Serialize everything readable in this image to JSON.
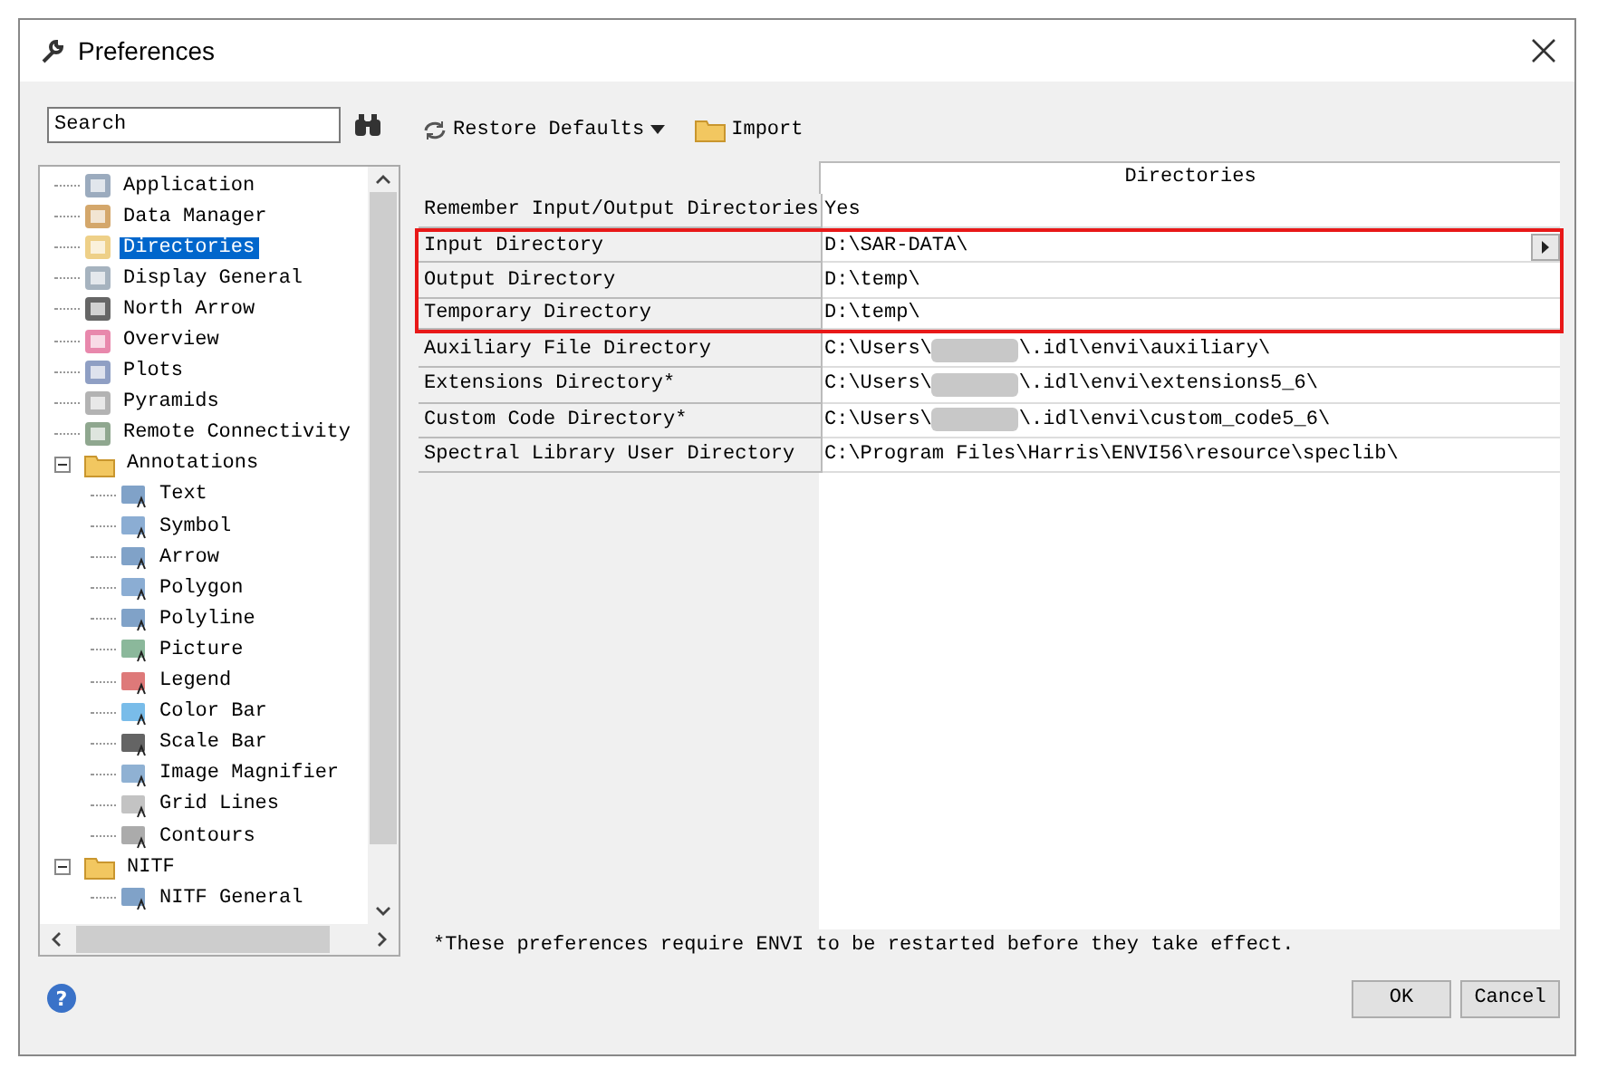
{
  "window": {
    "title": "Preferences"
  },
  "search": {
    "placeholder": "Search"
  },
  "tree": [
    {
      "label": "Application",
      "selected": false
    },
    {
      "label": "Data Manager",
      "selected": false
    },
    {
      "label": "Directories",
      "selected": true
    },
    {
      "label": "Display General",
      "selected": false
    },
    {
      "label": "North Arrow",
      "selected": false
    },
    {
      "label": "Overview",
      "selected": false
    },
    {
      "label": "Plots",
      "selected": false
    },
    {
      "label": "Pyramids",
      "selected": false
    },
    {
      "label": "Remote Connectivity",
      "selected": false
    },
    {
      "label": "Annotations",
      "selected": false,
      "expanded": true,
      "children": [
        {
          "label": "Text",
          "selected": false
        },
        {
          "label": "Symbol",
          "selected": false
        },
        {
          "label": "Arrow",
          "selected": false
        },
        {
          "label": "Polygon",
          "selected": false
        },
        {
          "label": "Polyline",
          "selected": false
        },
        {
          "label": "Picture",
          "selected": false
        },
        {
          "label": "Legend",
          "selected": false
        },
        {
          "label": "Color Bar",
          "selected": false
        },
        {
          "label": "Scale Bar",
          "selected": false
        },
        {
          "label": "Image Magnifier",
          "selected": false
        },
        {
          "label": "Grid Lines",
          "selected": false
        },
        {
          "label": "Contours",
          "selected": false
        }
      ]
    },
    {
      "label": "NITF",
      "selected": false,
      "expanded": true,
      "children": [
        {
          "label": "NITF General",
          "selected": false
        }
      ]
    }
  ],
  "toolbar": {
    "restore": "Restore Defaults",
    "import": "Import"
  },
  "table": {
    "column": "Directories",
    "rows": [
      {
        "name": "Remember Input/Output Directories",
        "value": "Yes",
        "highlighted": false
      },
      {
        "name": "Input Directory",
        "value": "D:\\SAR-DATA\\",
        "highlighted": true,
        "expand_button": true
      },
      {
        "name": "Output Directory",
        "value": "D:\\temp\\",
        "highlighted": true
      },
      {
        "name": "Temporary Directory",
        "value": "D:\\temp\\",
        "highlighted": true
      },
      {
        "name": "Auxiliary File Directory",
        "value": "C:\\Users\\",
        "value_end": "\\.idl\\envi\\auxiliary\\",
        "highlighted": false
      },
      {
        "name": "Extensions Directory*",
        "value": "C:\\Users\\",
        "value_end": "\\.idl\\envi\\extensions5_6\\",
        "highlighted": false
      },
      {
        "name": "Custom Code Directory*",
        "value": "C:\\Users\\",
        "value_end": "\\.idl\\envi\\custom_code5_6\\",
        "highlighted": false
      },
      {
        "name": "Spectral Library User Directory",
        "value": "C:\\Program Files\\Harris\\ENVI56\\resource\\speclib\\",
        "highlighted": false
      }
    ]
  },
  "footnote": "*These preferences require ENVI to be restarted before they take effect.",
  "help": "?",
  "buttons": [
    "OK",
    "Cancel"
  ]
}
